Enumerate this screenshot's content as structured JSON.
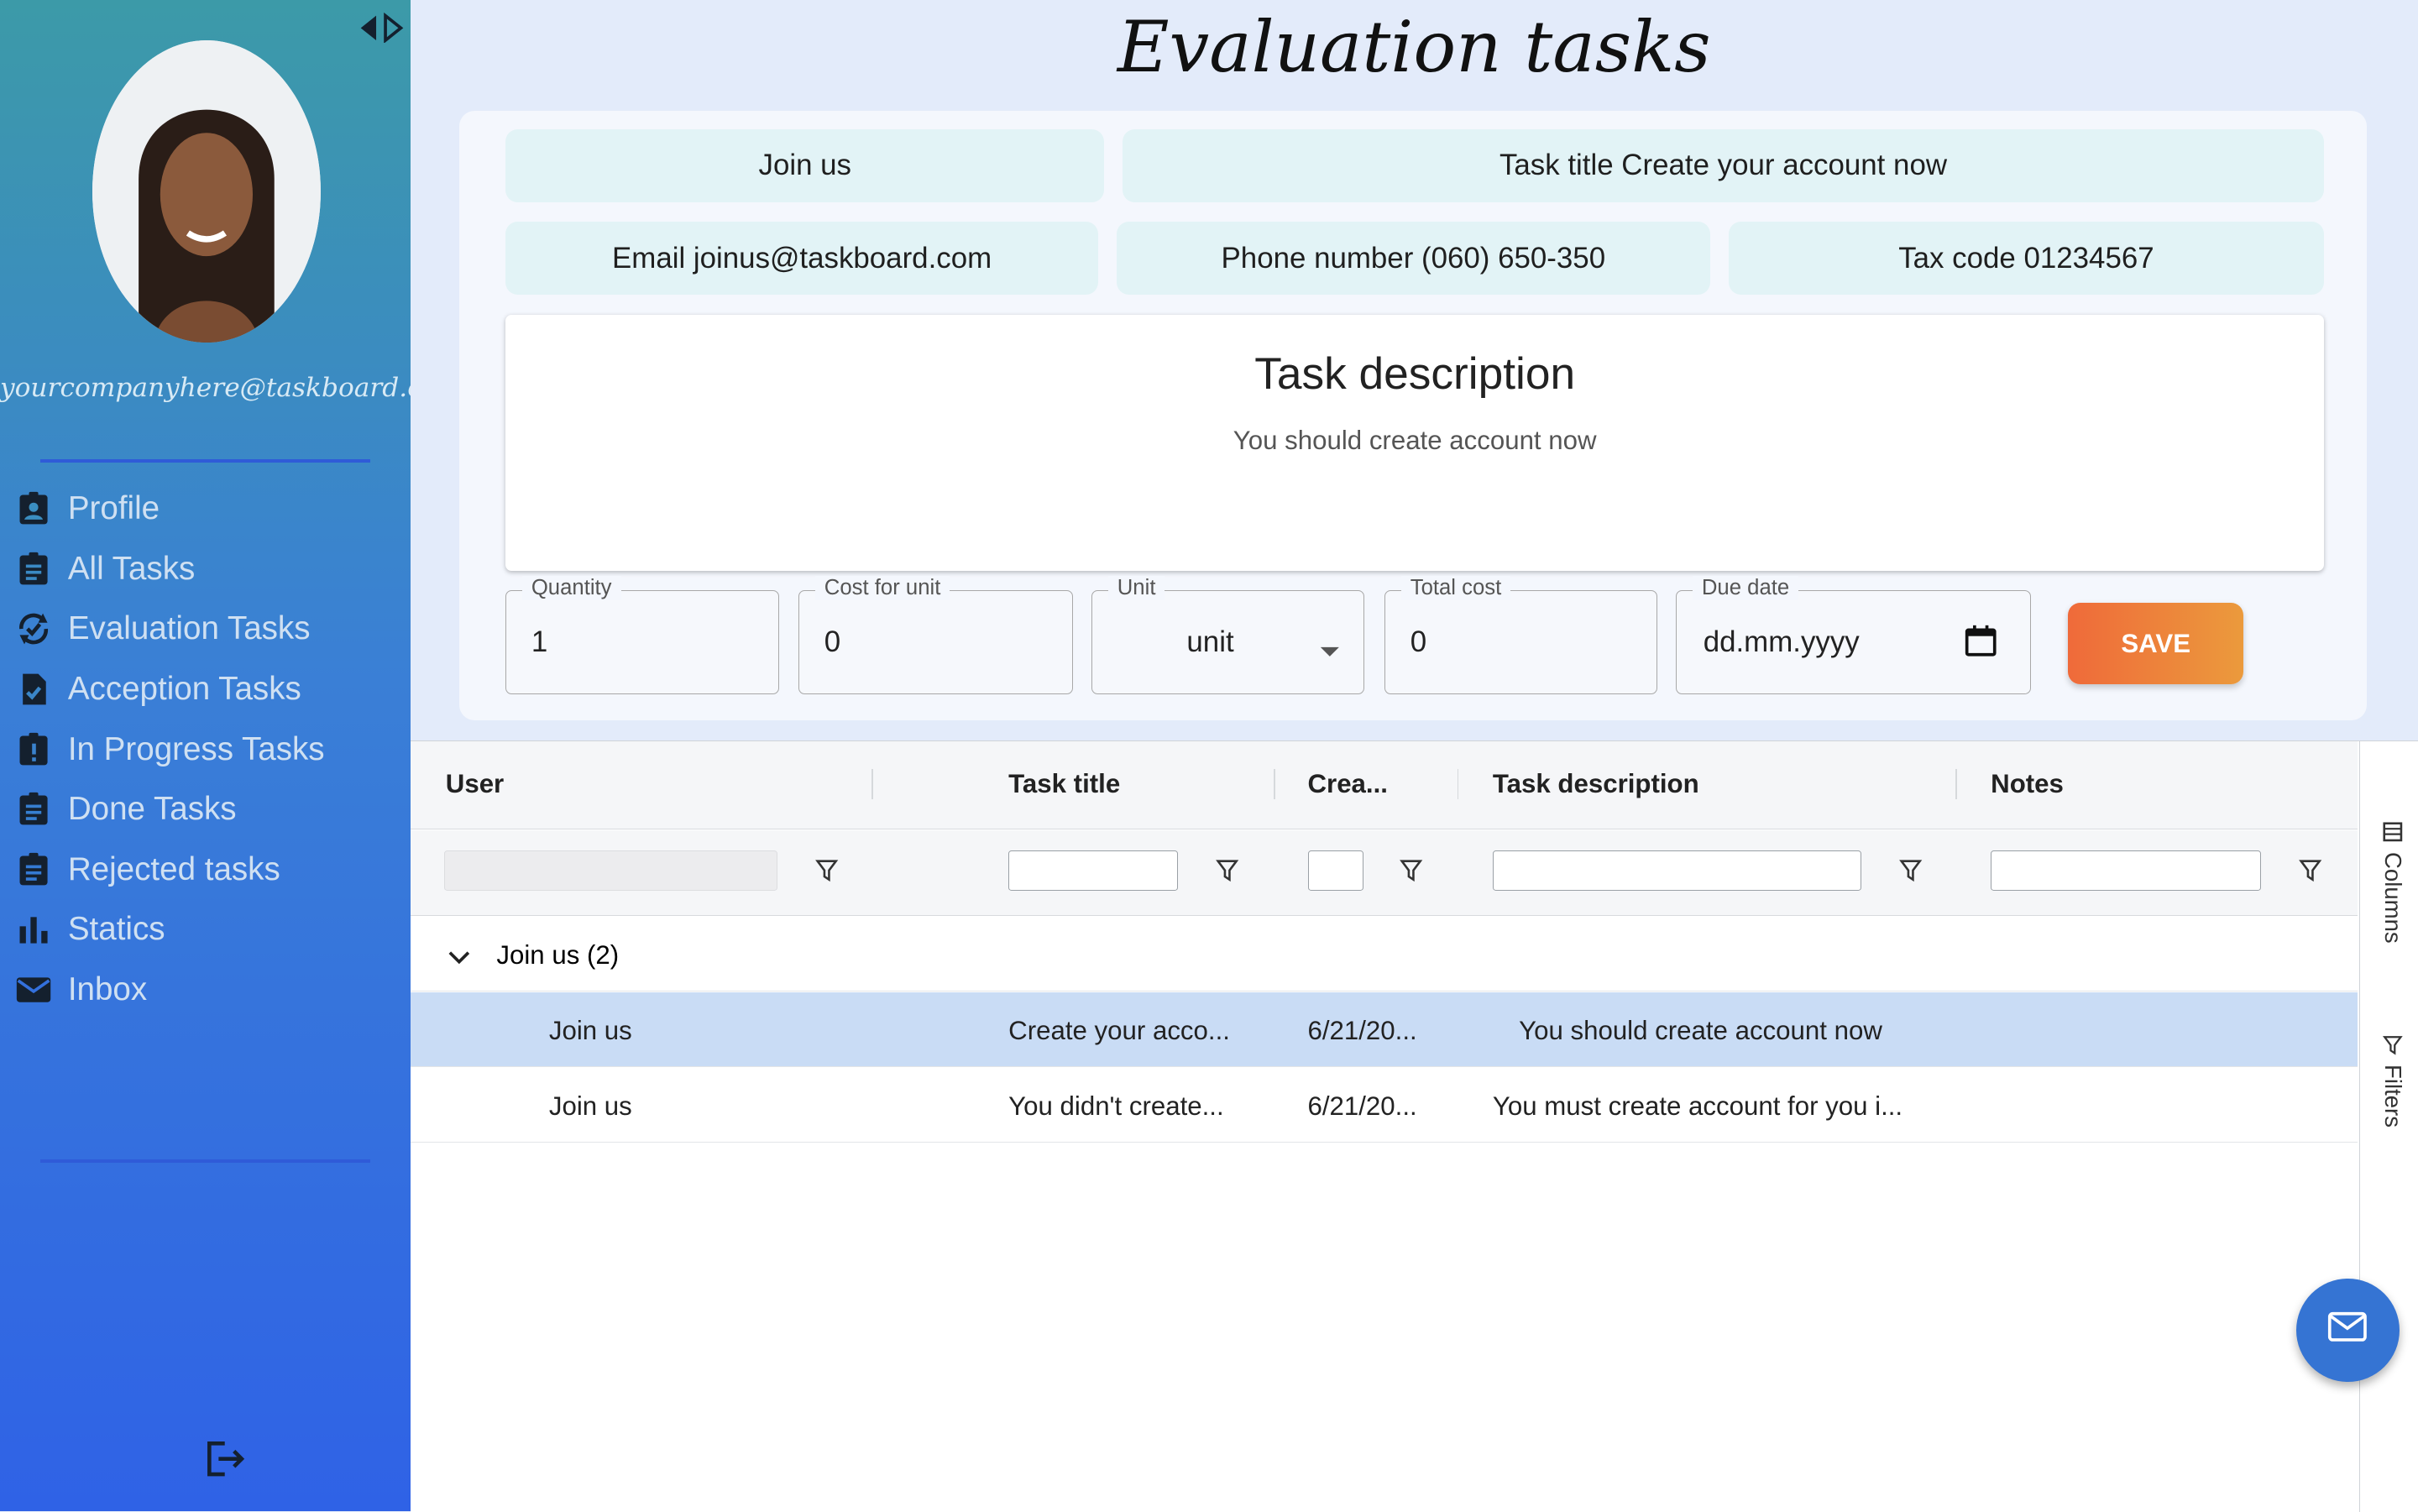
{
  "sidebar": {
    "email": "yourcompanyhere@taskboard.com",
    "items": [
      {
        "label": "Profile",
        "icon": "badge-icon"
      },
      {
        "label": "All Tasks",
        "icon": "clipboard-list-icon"
      },
      {
        "label": "Evaluation Tasks",
        "icon": "sync-check-icon"
      },
      {
        "label": "Acception Tasks",
        "icon": "file-check-icon"
      },
      {
        "label": "In Progress Tasks",
        "icon": "clipboard-alert-icon"
      },
      {
        "label": "Done Tasks",
        "icon": "clipboard-list-icon"
      },
      {
        "label": "Rejected tasks",
        "icon": "clipboard-list-icon"
      },
      {
        "label": "Statics",
        "icon": "bar-chart-icon"
      },
      {
        "label": "Inbox",
        "icon": "mail-icon"
      }
    ]
  },
  "page": {
    "title": "Evaluation tasks"
  },
  "task": {
    "company": "Join us",
    "title": "Task title Create your account now",
    "email": "Email joinus@taskboard.com",
    "phone": "Phone number (060) 650-350",
    "tax": "Tax code 01234567",
    "desc_heading": "Task description",
    "desc_text": "You should create account now"
  },
  "form": {
    "quantity": {
      "label": "Quantity",
      "value": "1"
    },
    "cost": {
      "label": "Cost for unit",
      "value": "0"
    },
    "unit": {
      "label": "Unit",
      "value": "unit"
    },
    "total": {
      "label": "Total cost",
      "value": "0"
    },
    "due": {
      "label": "Due date",
      "placeholder": "dd.mm.yyyy"
    },
    "save_label": "SAVE"
  },
  "grid": {
    "columns": [
      "User",
      "Task title",
      "Crea...",
      "Task description",
      "Notes"
    ],
    "group_label": "Join us (2)",
    "rows": [
      {
        "user": "Join us",
        "title": "Create your acco...",
        "created": "6/21/20...",
        "description": "You should create account now",
        "notes": ""
      },
      {
        "user": "Join us",
        "title": "You didn't create...",
        "created": "6/21/20...",
        "description": "You must create account for you i...",
        "notes": ""
      }
    ],
    "side_columns": "Columns",
    "side_filters": "Filters"
  },
  "colors": {
    "accent": "#3574d3",
    "save": "#ef6a3a",
    "selected_row": "#c9dcf5"
  }
}
